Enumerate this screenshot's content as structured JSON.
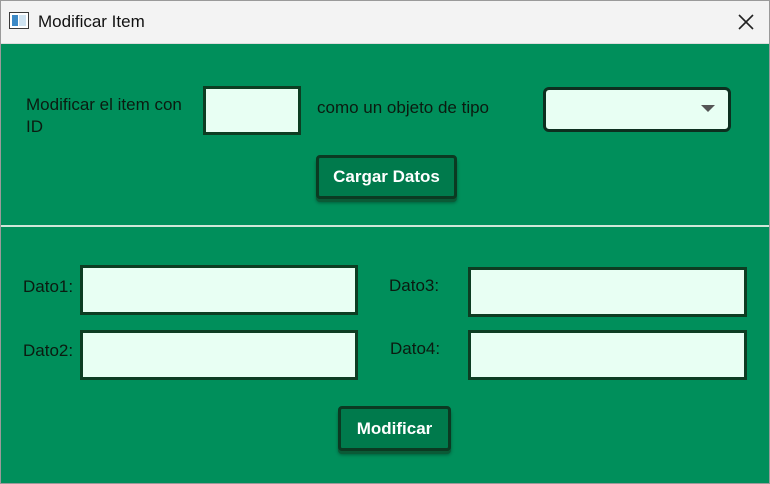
{
  "window": {
    "title": "Modificar Item"
  },
  "icons": {
    "app": "window-app-icon",
    "close": "close-icon",
    "dropdown": "chevron-down-icon"
  },
  "colors": {
    "background": "#008f5b",
    "field_fill": "#e8fff3",
    "button_fill": "#007a4c",
    "button_text": "#ffffff"
  },
  "top_section": {
    "item_id_label": "Modificar el item con ID",
    "item_id_value": "",
    "type_label": "como un objeto de tipo",
    "type_selected": "",
    "load_button": "Cargar Datos"
  },
  "data_section": {
    "dato1_label": "Dato1:",
    "dato1_value": "",
    "dato2_label": "Dato2:",
    "dato2_value": "",
    "dato3_label": "Dato3:",
    "dato3_value": "",
    "dato4_label": "Dato4:",
    "dato4_value": "",
    "modify_button": "Modificar"
  }
}
